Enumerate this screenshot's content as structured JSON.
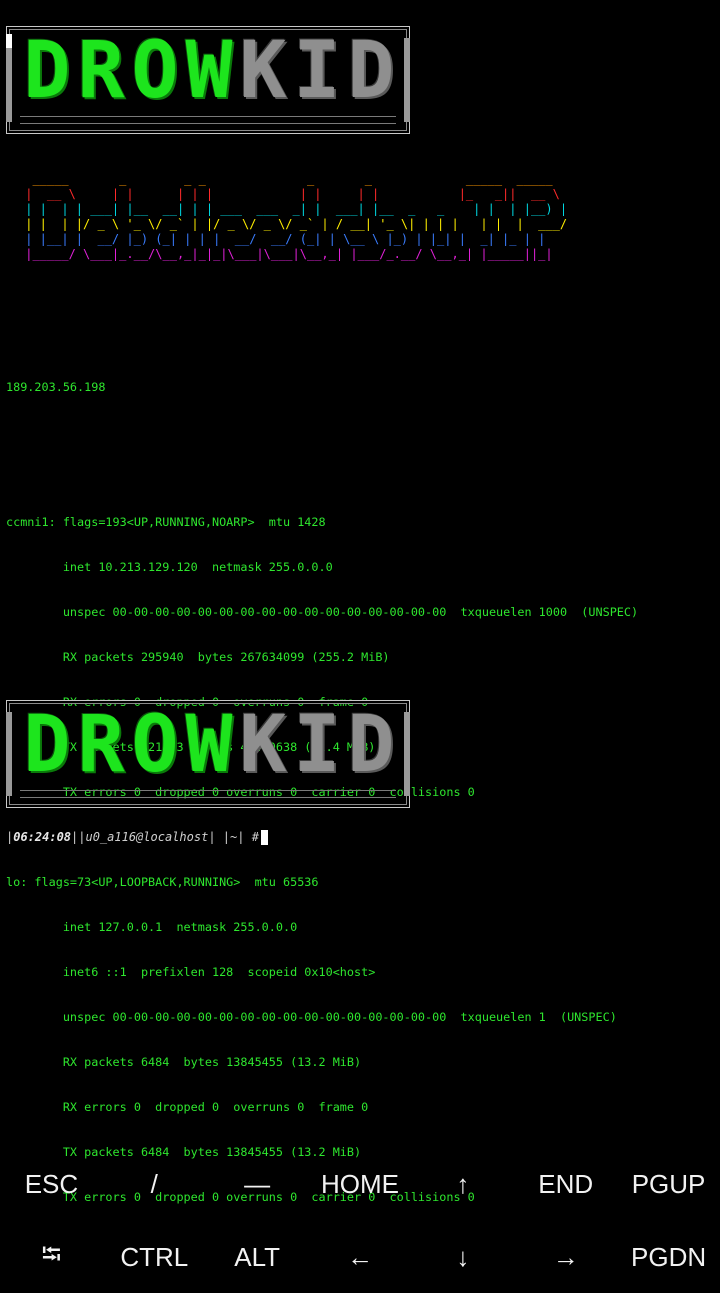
{
  "banner": {
    "green_letters": [
      "D",
      "R",
      "O",
      "W"
    ],
    "gray_letters": [
      "K",
      "I",
      "D"
    ]
  },
  "figlet_lines": [
    "  _____       _        _ _              _       _             _____  _____ ",
    " |  __ \\     | |      | | |            | |     | |           |_   _||  __ \\",
    " | |  | | ___| |__  __| | | ___  ___  _| |  ___| |__  _   _    | |  | |__) |",
    " | |  | |/ _ \\ '_ \\/ _` | |/ _ \\/ _ \\/ _` | / __| '_ \\| | | |   | |  |  ___/",
    " | |__| |  __/ |_) (_| | | |  __/  __/ (_| | \\__ \\ |_) | |_| |  _| |_ | |    ",
    " |_____/ \\___|_.__/\\__,_|_|_|\\___|\\___|\\__,_| |___/_.__/ \\__,_| |_____||_|    "
  ],
  "terminal": {
    "lines": [
      "189.203.56.198",
      "",
      "",
      "ccmni1: flags=193<UP,RUNNING,NOARP>  mtu 1428",
      "        inet 10.213.129.120  netmask 255.0.0.0",
      "        unspec 00-00-00-00-00-00-00-00-00-00-00-00-00-00-00-00  txqueuelen 1000  (UNSPEC)",
      "        RX packets 295940  bytes 267634099 (255.2 MiB)",
      "        RX errors 0  dropped 0  overruns 0  frame 0",
      "        TX packets 221413  bytes 44470638 (42.4 MiB)",
      "        TX errors 0  dropped 0 overruns 0  carrier 0  collisions 0",
      "",
      "lo: flags=73<UP,LOOPBACK,RUNNING>  mtu 65536",
      "        inet 127.0.0.1  netmask 255.0.0.0",
      "        inet6 ::1  prefixlen 128  scopeid 0x10<host>",
      "        unspec 00-00-00-00-00-00-00-00-00-00-00-00-00-00-00-00  txqueuelen 1  (UNSPEC)",
      "        RX packets 6484  bytes 13845455 (13.2 MiB)",
      "        RX errors 0  dropped 0  overruns 0  frame 0",
      "        TX packets 6484  bytes 13845455 (13.2 MiB)",
      "        TX errors 0  dropped 0 overruns 0  carrier 0  collisions 0"
    ]
  },
  "prompt": {
    "open": "|",
    "time": "06:24:08",
    "sep1": "||",
    "user_host": "u0_a116@localhost",
    "sep2": "| |",
    "cwd": "~",
    "close": "| ",
    "symbol": "#"
  },
  "extra_keys": {
    "row1": [
      "ESC",
      "/",
      "—",
      "HOME",
      "↑",
      "END",
      "PGUP"
    ],
    "row2": [
      "⭾",
      "CTRL",
      "ALT",
      "←",
      "↓",
      "→",
      "PGDN"
    ]
  },
  "colors": {
    "background": "#000000",
    "terminal_text": "#2ee62e",
    "banner_green": "#1de51d",
    "banner_gray": "#8f8f8f"
  }
}
